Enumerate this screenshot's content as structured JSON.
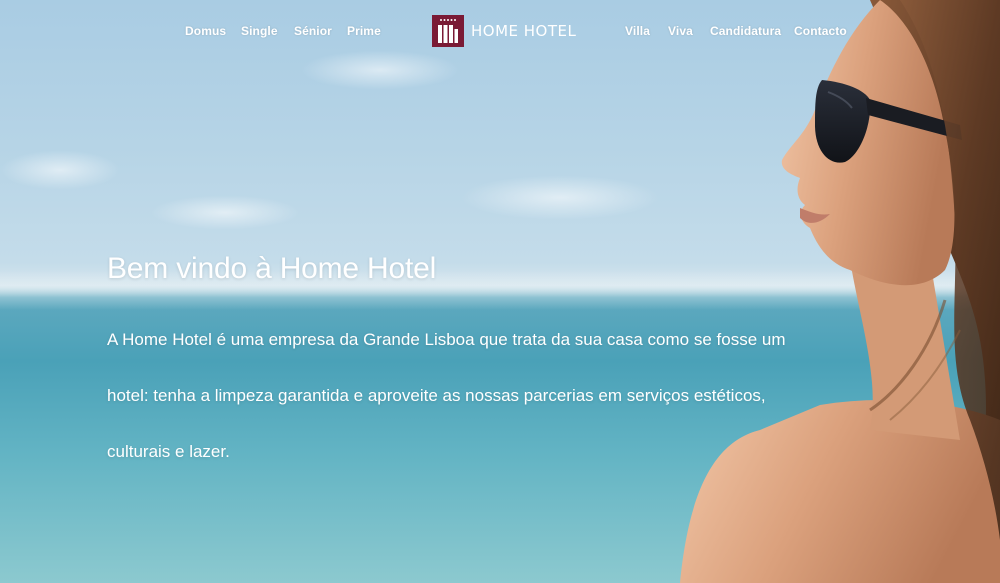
{
  "nav": {
    "left": [
      "Domus",
      "Single",
      "Sénior",
      "Prime"
    ],
    "right": [
      "Villa",
      "Viva",
      "Candidatura",
      "Contacto"
    ],
    "logo_text": "HOME HOTEL"
  },
  "hero": {
    "title": "Bem vindo à Home Hotel",
    "paragraph": "A Home Hotel é uma empresa da Grande Lisboa que trata da sua casa como se fosse um hotel: tenha a limpeza garantida e aproveite as nossas parcerias em serviços estéticos, culturais e lazer."
  },
  "colors": {
    "brand": "#7a1a35",
    "text": "#ffffff",
    "sky": "#a9cce3",
    "sea": "#4aa1b8"
  },
  "icons": {
    "logo": "building-icon"
  }
}
